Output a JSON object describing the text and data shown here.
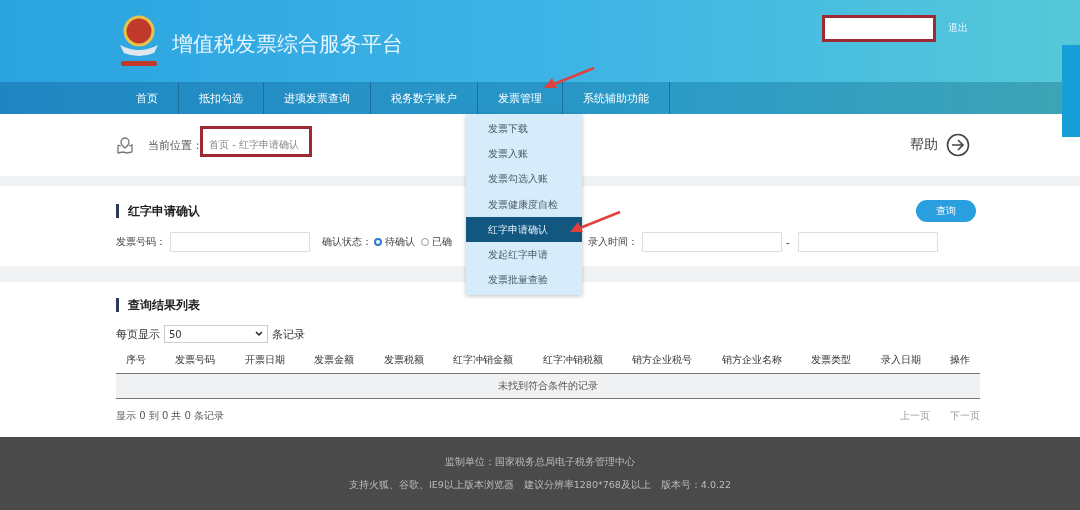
{
  "header": {
    "title": "增值税发票综合服务平台",
    "logout": "退出"
  },
  "nav": [
    {
      "label": "首页"
    },
    {
      "label": "抵扣勾选"
    },
    {
      "label": "进项发票查询"
    },
    {
      "label": "税务数字账户"
    },
    {
      "label": "发票管理"
    },
    {
      "label": "系统辅助功能"
    }
  ],
  "dropdown": [
    {
      "label": "发票下载",
      "selected": false
    },
    {
      "label": "发票入账",
      "selected": false
    },
    {
      "label": "发票勾选入账",
      "selected": false
    },
    {
      "label": "发票健康度自检",
      "selected": false
    },
    {
      "label": "红字申请确认",
      "selected": true
    },
    {
      "label": "发起红字申请",
      "selected": false
    },
    {
      "label": "发票批量查验",
      "selected": false
    }
  ],
  "breadcrumb": {
    "label": "当前位置：",
    "path": "首页 - 红字申请确认"
  },
  "help": "帮助",
  "query": {
    "title": "红字申请确认",
    "invoice_label": "发票号码：",
    "status_label": "确认状态：",
    "radios": [
      {
        "label": "待确认",
        "selected": true
      },
      {
        "label": "已确",
        "selected": false
      }
    ],
    "time_label": "录入时间：",
    "separator": "-",
    "button": "查询"
  },
  "results": {
    "title": "查询结果列表",
    "page_label": "每页显示",
    "page_size": "50",
    "page_unit": "条记录",
    "columns": [
      "序号",
      "发票号码",
      "开票日期",
      "发票金额",
      "发票税额",
      "红字冲销金额",
      "红字冲销税额",
      "销方企业税号",
      "销方企业名称",
      "发票类型",
      "录入日期",
      "操作"
    ],
    "empty": "未找到符合条件的记录",
    "summary": "显示 0 到 0 共 0 条记录",
    "prev": "上一页",
    "next": "下一页"
  },
  "footer": [
    "监制单位：国家税务总局电子税务管理中心",
    "支持火狐、谷歌、IE9以上版本浏览器　建议分辨率1280*768及以上　版本号：4.0.22"
  ],
  "annotations": [
    {
      "kind": "box"
    },
    {
      "kind": "box"
    },
    {
      "kind": "arrow"
    },
    {
      "kind": "arrow"
    }
  ]
}
